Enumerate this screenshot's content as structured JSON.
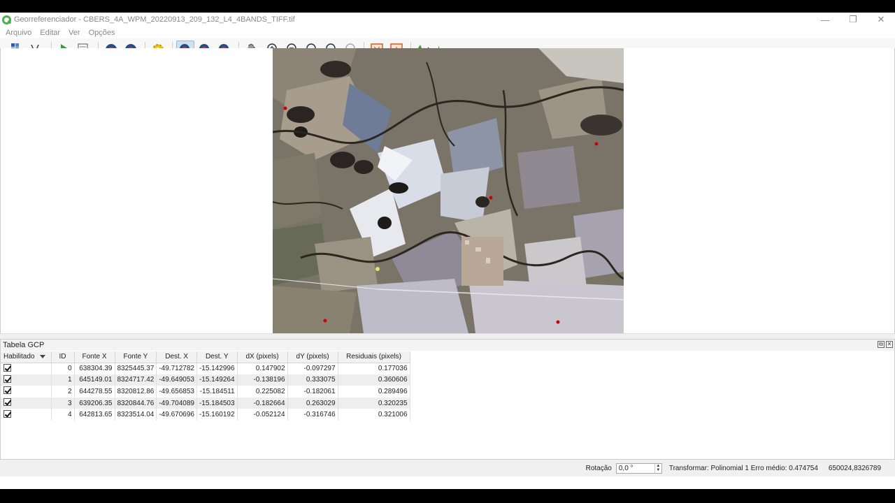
{
  "window": {
    "title": "Georreferenciador - CBERS_4A_WPM_20220913_209_132_L4_4BANDS_TIFF.tif",
    "controls": {
      "minimize": "—",
      "restore": "❐",
      "close": "✕"
    }
  },
  "menu": [
    "Arquivo",
    "Editar",
    "Ver",
    "Opções"
  ],
  "toolbar": {
    "icons": [
      "open-raster-icon",
      "start-georeferencing-icon",
      "generate-script-icon",
      "load-gcp-icon",
      "save-gcp-icon",
      "transform-settings-icon",
      "add-point-icon",
      "delete-point-icon",
      "move-gcp-icon",
      "pan-icon",
      "zoom-in-icon",
      "zoom-out-icon",
      "zoom-to-layer-icon",
      "zoom-last-icon",
      "zoom-next-icon",
      "link-georef-to-qgis-icon",
      "link-qgis-to-georef-icon",
      "full-histogram-stretch-icon",
      "local-histogram-stretch-icon"
    ]
  },
  "gcp": {
    "title": "Tabela GCP",
    "columns": [
      "Habilitado",
      "ID",
      "Fonte X",
      "Fonte Y",
      "Dest. X",
      "Dest. Y",
      "dX (pixels)",
      "dY (pixels)",
      "Residuais (pixels)"
    ],
    "rows": [
      {
        "enabled": true,
        "id": "0",
        "src_x": "638304.39",
        "src_y": "8325445.37",
        "dst_x": "-49.712782",
        "dst_y": "-15.142996",
        "dx": "0.147902",
        "dy": "-0.097297",
        "res": "0.177036"
      },
      {
        "enabled": true,
        "id": "1",
        "src_x": "645149.01",
        "src_y": "8324717.42",
        "dst_x": "-49.649053",
        "dst_y": "-15.149264",
        "dx": "-0.138196",
        "dy": "0.333075",
        "res": "0.360606"
      },
      {
        "enabled": true,
        "id": "2",
        "src_x": "644278.55",
        "src_y": "8320812.86",
        "dst_x": "-49.656853",
        "dst_y": "-15.184511",
        "dx": "0.225082",
        "dy": "-0.182061",
        "res": "0.289496"
      },
      {
        "enabled": true,
        "id": "3",
        "src_x": "639206.35",
        "src_y": "8320844.76",
        "dst_x": "-49.704089",
        "dst_y": "-15.184503",
        "dx": "-0.182664",
        "dy": "0.263029",
        "res": "0.320235"
      },
      {
        "enabled": true,
        "id": "4",
        "src_x": "642813.65",
        "src_y": "8323514.04",
        "dst_x": "-49.670696",
        "dst_y": "-15.160192",
        "dx": "-0.052124",
        "dy": "-0.316746",
        "res": "0.321006"
      }
    ]
  },
  "status": {
    "rotation_label": "Rotação",
    "rotation_value": "0,0 °",
    "transform": "Transformar: Polinomial 1 Erro médio: 0.474754",
    "coords": "650024,8326789"
  },
  "colors": {
    "accent": "#4caf50",
    "gcp_marker": "#cc0000",
    "raster_base": "#7a7468"
  }
}
